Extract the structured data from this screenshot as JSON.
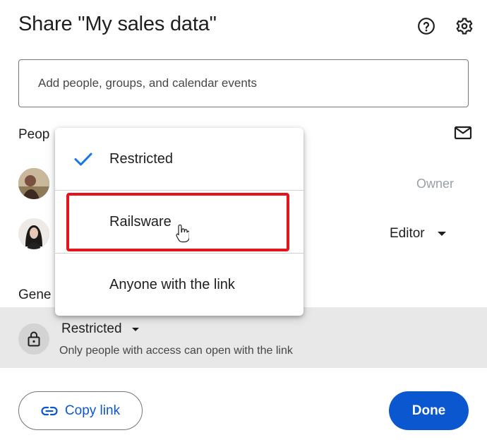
{
  "dialog": {
    "title": "Share \"My sales data\"",
    "help_icon": "help-circle-icon",
    "settings_icon": "gear-icon"
  },
  "add_people": {
    "placeholder": "Add people, groups, and calendar events"
  },
  "people_section": {
    "label": "Peop",
    "email_icon": "mail-icon",
    "members": [
      {
        "avatar": "avatar-photo-man",
        "role": "Owner"
      },
      {
        "avatar": "avatar-photo-woman",
        "role": "Editor"
      }
    ]
  },
  "general_access": {
    "label": "Gene",
    "icon": "lock-icon",
    "selected": "Restricted",
    "description": "Only people with access can open with the link"
  },
  "access_menu": {
    "items": [
      {
        "label": "Restricted",
        "checked": true
      },
      {
        "label": "Railsware",
        "checked": false,
        "highlighted": true
      },
      {
        "label": "Anyone with the link",
        "checked": false
      }
    ]
  },
  "footer": {
    "copy_link_label": "Copy link",
    "copy_link_icon": "link-icon",
    "done_label": "Done"
  },
  "colors": {
    "accent": "#0b57d0",
    "highlight_box": "#e3141b",
    "check": "#1a73e8"
  }
}
